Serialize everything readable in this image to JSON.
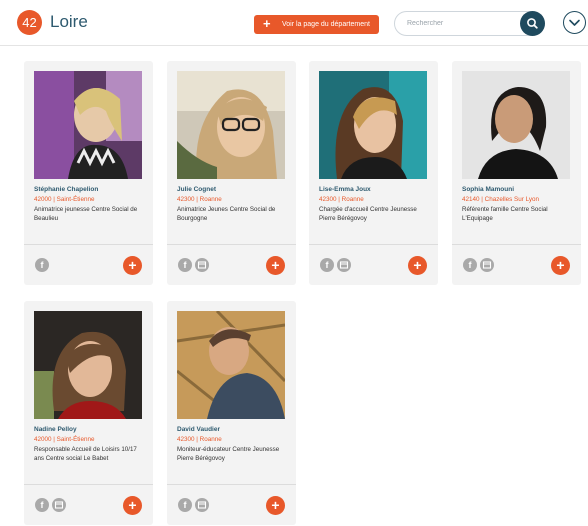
{
  "header": {
    "dept_number": "42",
    "dept_name": "Loire",
    "dept_button_label": "Voir la page du département",
    "search_placeholder": "Rechercher"
  },
  "colors": {
    "accent": "#e8582a",
    "primary": "#2e5a6f",
    "dark": "#1f4a5e",
    "card": "#f3f3f3"
  },
  "cards": [
    {
      "name": "Stéphanie Chapelion",
      "location": "42000 | Saint-Étienne",
      "role": "Animatrice jeunesse Centre Social de Beaulieu",
      "web": false
    },
    {
      "name": "Julie Cognet",
      "location": "42300 | Roanne",
      "role": "Animatrice Jeunes Centre Social de Bourgogne",
      "web": true
    },
    {
      "name": "Lise-Emma Joux",
      "location": "42300 | Roanne",
      "role": "Chargée d'accueil Centre Jeunesse Pierre Bérégovoy",
      "web": true
    },
    {
      "name": "Sophia Mamouni",
      "location": "42140 | Chazelles Sur Lyon",
      "role": "Référente famille Centre Social L'Equipage",
      "web": true
    },
    {
      "name": "Nadine Pelloy",
      "location": "42000 | Saint-Étienne",
      "role": "Responsable Accueil de Loisirs 10/17 ans Centre social Le Babet",
      "web": true
    },
    {
      "name": "David Vaudier",
      "location": "42300 | Roanne",
      "role": "Moniteur-éducateur Centre Jeunesse Pierre Bérégovoy",
      "web": true
    }
  ]
}
